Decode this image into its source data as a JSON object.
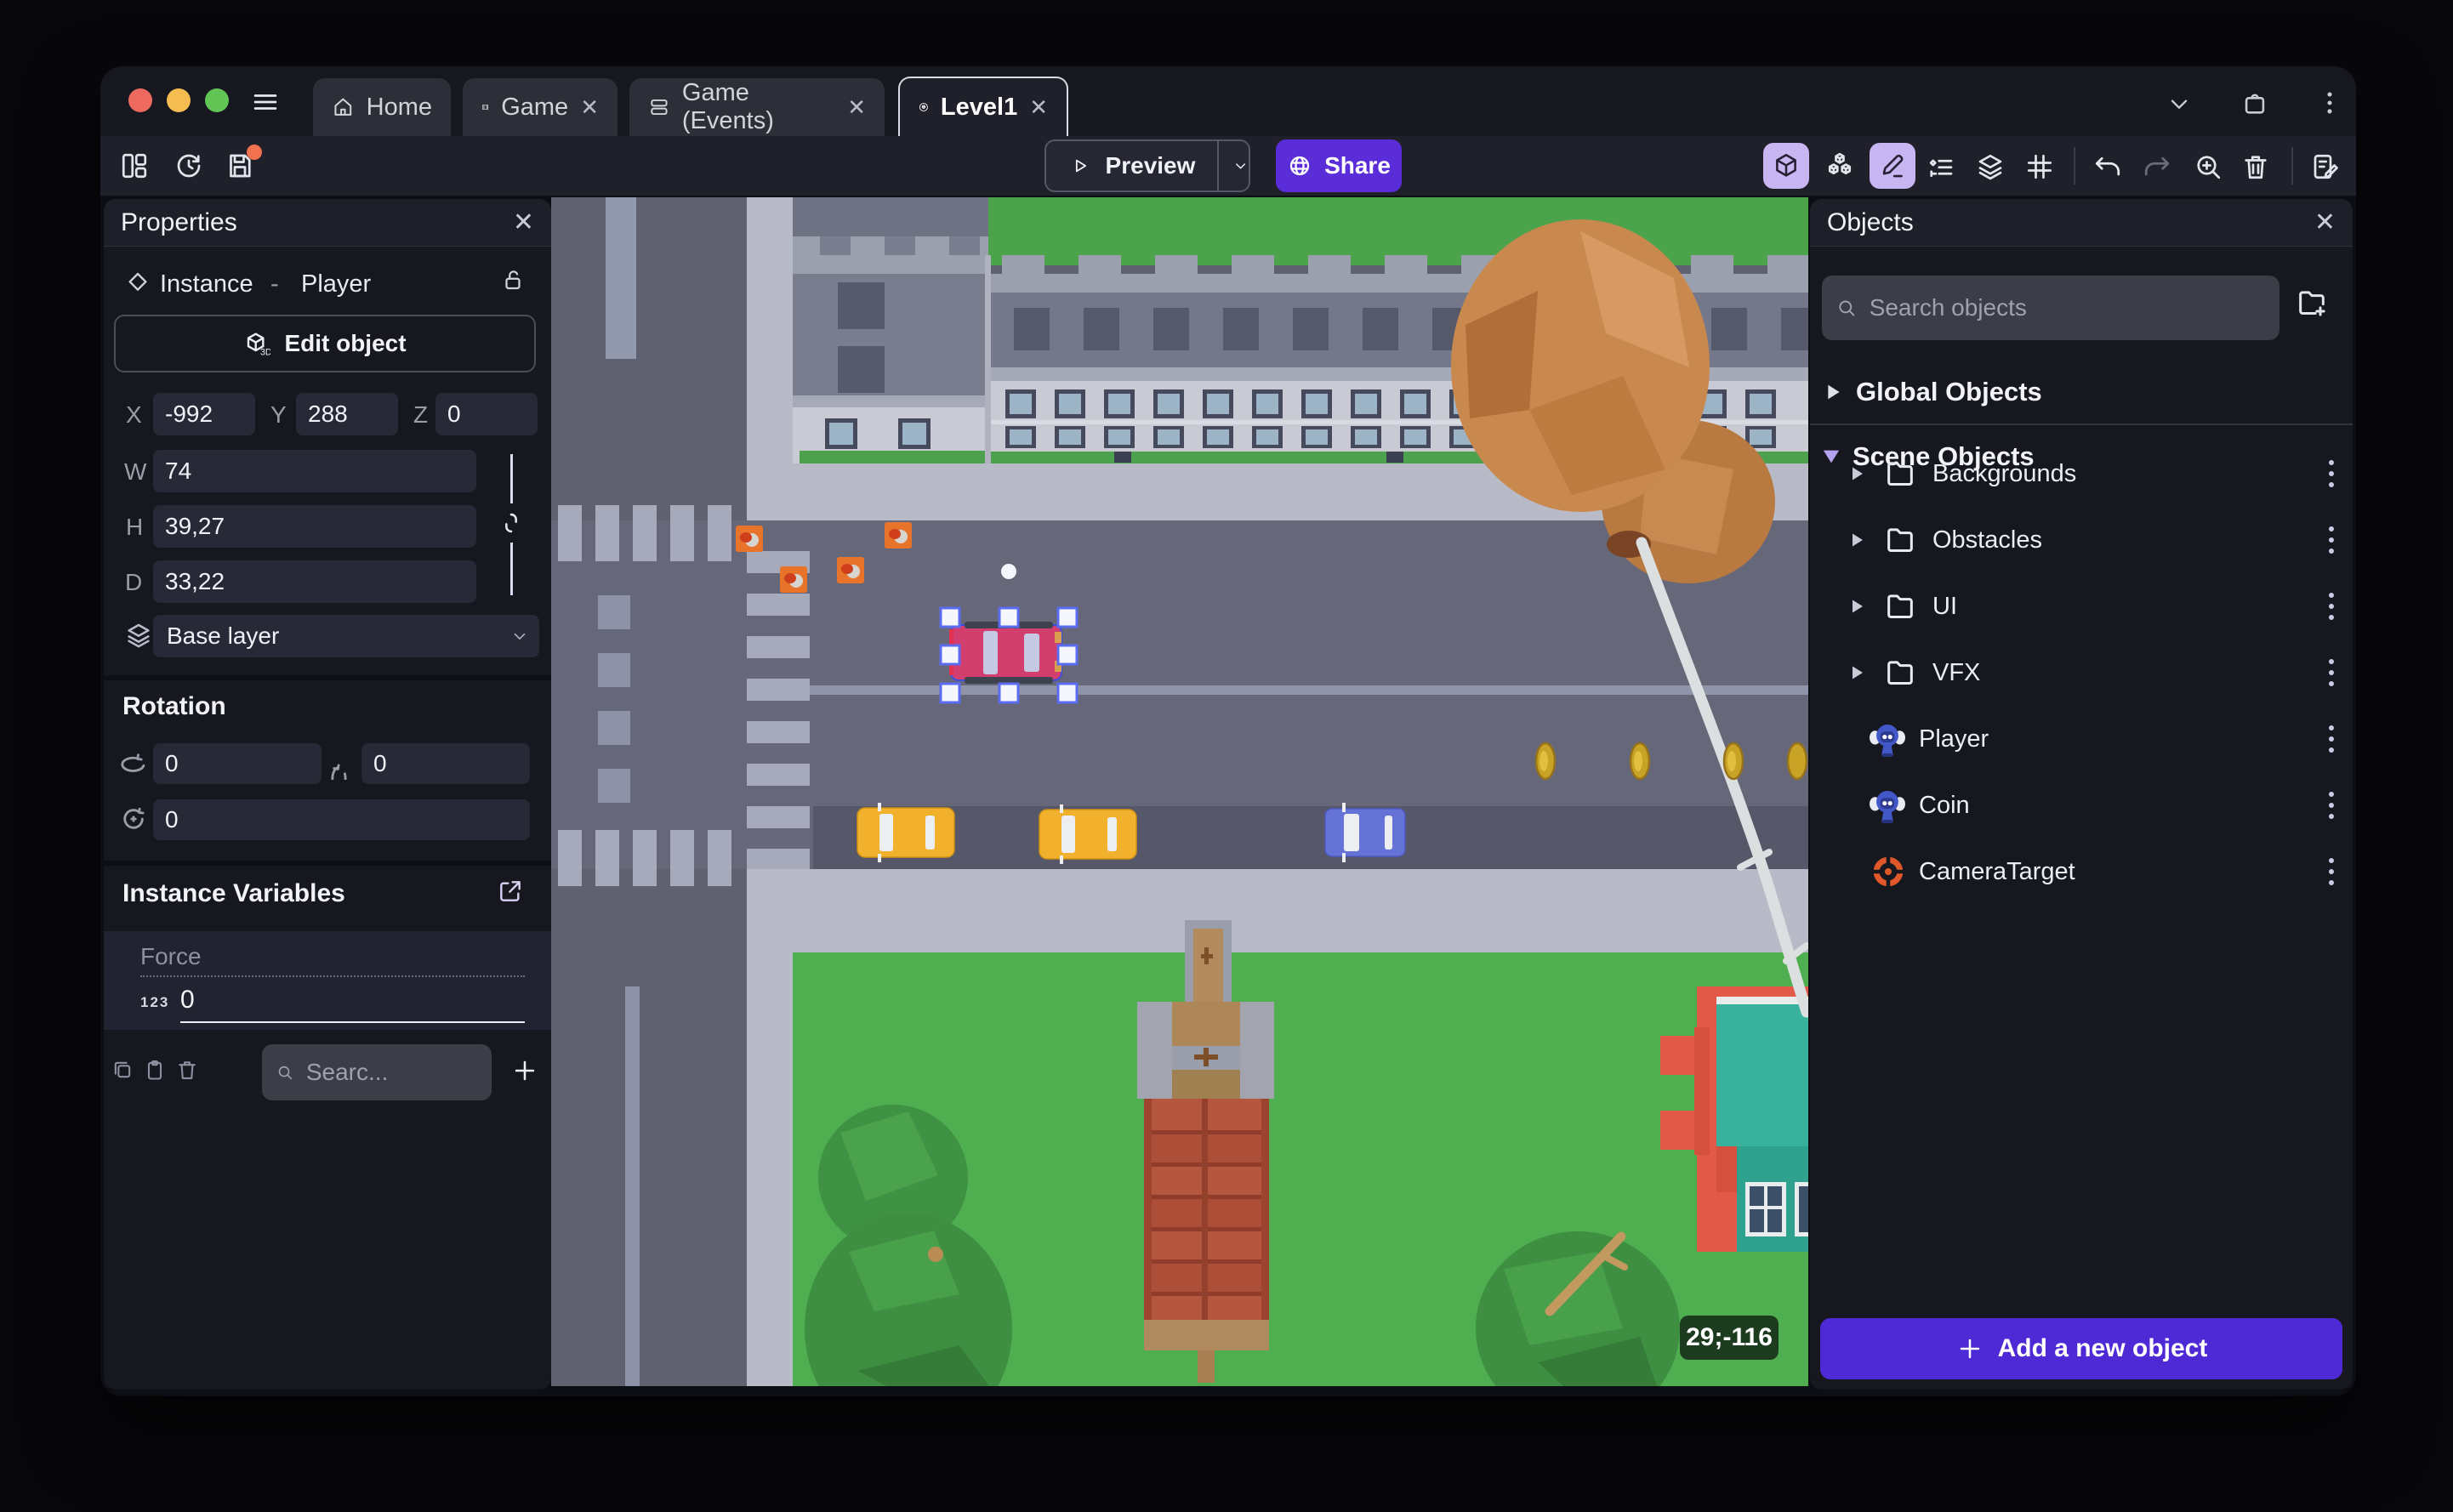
{
  "titlebar": {
    "tabs": [
      {
        "label": "Home"
      },
      {
        "label": "Game"
      },
      {
        "label": "Game (Events)"
      },
      {
        "label": "Level1"
      }
    ]
  },
  "toolbar": {
    "preview": "Preview",
    "share": "Share"
  },
  "properties": {
    "title": "Properties",
    "instance_label": "Instance",
    "separator": "-",
    "instance_name": "Player",
    "edit_object": "Edit object",
    "x_label": "X",
    "x_value": "-992",
    "y_label": "Y",
    "y_value": "288",
    "z_label": "Z",
    "z_value": "0",
    "w_label": "W",
    "w_value": "74",
    "h_label": "H",
    "h_value": "39,27",
    "d_label": "D",
    "d_value": "33,22",
    "layer_value": "Base layer",
    "rotation_title": "Rotation",
    "rotation_x": "0",
    "rotation_y": "0",
    "rotation_z": "0",
    "variables_title": "Instance Variables",
    "variable_name": "Force",
    "variable_type_badge": "123",
    "variable_value": "0",
    "search_placeholder": "Searc..."
  },
  "objects": {
    "title": "Objects",
    "search_placeholder": "Search objects",
    "global_group": "Global Objects",
    "scene_group": "Scene Objects",
    "folders": [
      {
        "label": "Backgrounds"
      },
      {
        "label": "Obstacles"
      },
      {
        "label": "UI"
      },
      {
        "label": "VFX"
      }
    ],
    "items": [
      {
        "label": "Player",
        "icon": "monkey-sprite-icon"
      },
      {
        "label": "Coin",
        "icon": "monkey-sprite-icon"
      },
      {
        "label": "CameraTarget",
        "icon": "target-icon"
      }
    ],
    "add_button": "Add a new object"
  },
  "scene": {
    "cursor_coordinates": "29;-116"
  },
  "icons": {
    "active_tools": [
      "3d-view-icon",
      "pencil-edit-icon"
    ],
    "left_toolbar": [
      "layout-panels-icon",
      "history-icon",
      "save-icon"
    ],
    "right_toolbar": [
      "3d-view-icon",
      "objects-cubes-icon",
      "pencil-edit-icon",
      "instance-list-icon",
      "layers-icon",
      "grid-icon",
      "undo-icon",
      "redo-icon",
      "zoom-in-icon",
      "trash-icon",
      "notes-edit-icon"
    ]
  },
  "colors": {
    "accent": "#5b2dd9",
    "add_button": "#4e29d6",
    "active_tool_chip": "#c8b6f3",
    "selection": "#5b6cf0",
    "grass": "#4fae4f",
    "road": "#5f6170",
    "vfx_marker": "#e8742c",
    "save_badge": "#f2714f"
  }
}
